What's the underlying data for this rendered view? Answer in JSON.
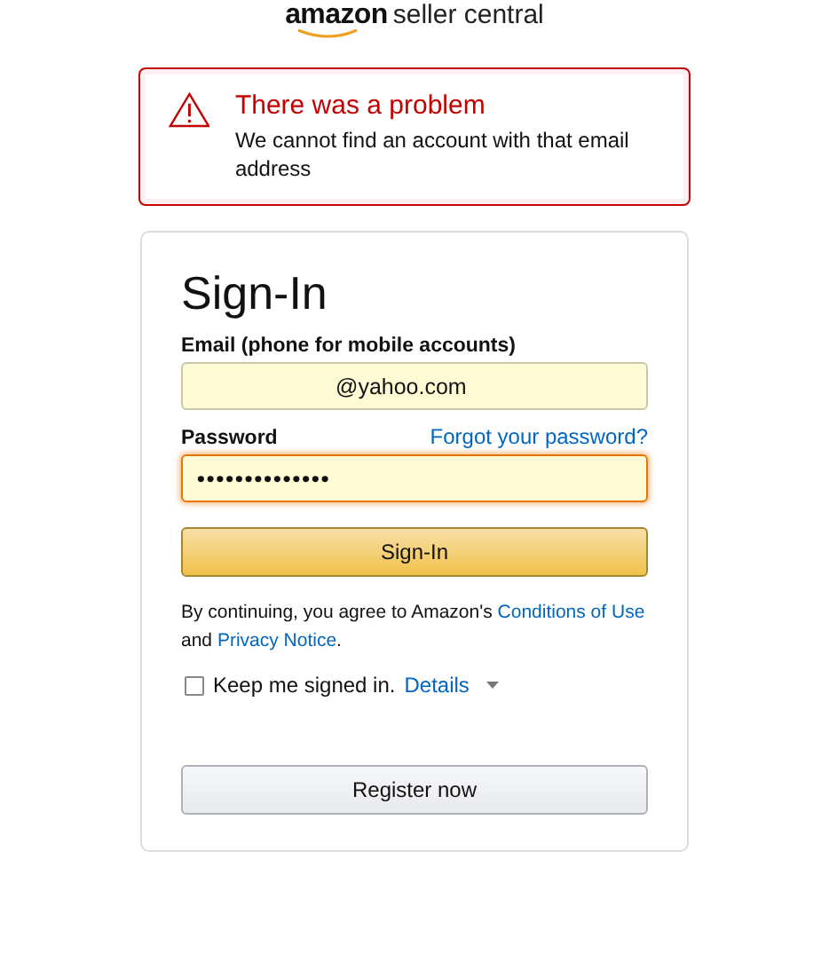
{
  "logo": {
    "brand": "amazon",
    "product": "seller central"
  },
  "alert": {
    "title": "There was a problem",
    "message": "We cannot find an account with that email address"
  },
  "signin": {
    "heading": "Sign-In",
    "email": {
      "label": "Email (phone for mobile accounts)",
      "value": "@yahoo.com",
      "invalid": false
    },
    "password": {
      "label": "Password",
      "forgot_link": "Forgot your password?",
      "value": "••••••••••••••",
      "focused": true
    },
    "submit": "Sign-In",
    "legal": [
      {
        "kind": "text",
        "text": "By continuing, you agree to Amazon's "
      },
      {
        "kind": "link",
        "text": "Conditions of Use"
      },
      {
        "kind": "text",
        "text": " and "
      },
      {
        "kind": "link",
        "text": "Privacy Notice"
      },
      {
        "kind": "text",
        "text": "."
      }
    ],
    "keep_signed_in": {
      "label": "Keep me signed in.",
      "checked": false,
      "details_link": "Details"
    },
    "register": "Register now"
  }
}
